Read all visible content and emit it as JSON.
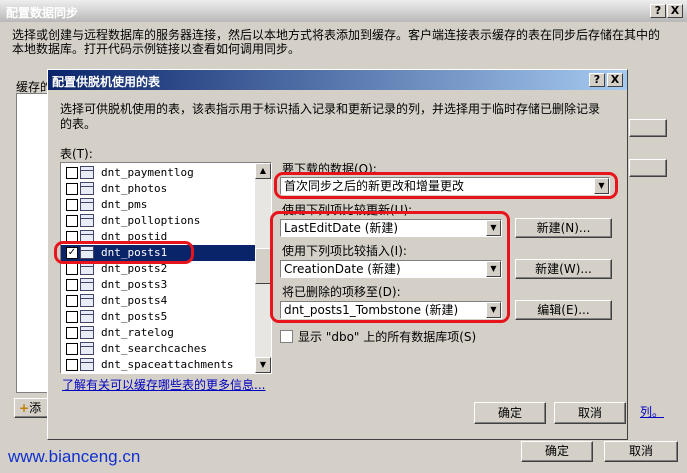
{
  "outer_dialog": {
    "title": "配置数据同步",
    "help_btn": "?",
    "close_btn": "X",
    "description_line1": "选择或创建与远程数据库的服务器连接，然后以本地方式将表添加到缓存。客户端连接表示缓存的表在同步后存储在其中的",
    "description_line2": "本地数据库。打开代码示例链接以查看如何调用同步。",
    "cache_label": "缓存的",
    "add_button": "添",
    "link_tail": "列。",
    "ok_button": "确定",
    "cancel_button": "取消"
  },
  "inner_dialog": {
    "title": "配置供脱机使用的表",
    "help_btn": "?",
    "close_btn": "X",
    "description_line1": "选择可供脱机使用的表，该表指示用于标识插入记录和更新记录的列，并选择用于临时存储已删除记录",
    "description_line2": "的表。",
    "tables_label": "表(T):",
    "tables": [
      {
        "name": "dnt_paymentlog",
        "checked": false
      },
      {
        "name": "dnt_photos",
        "checked": false
      },
      {
        "name": "dnt_pms",
        "checked": false
      },
      {
        "name": "dnt_polloptions",
        "checked": false
      },
      {
        "name": "dnt_postid",
        "checked": false
      },
      {
        "name": "dnt_posts1",
        "checked": true
      },
      {
        "name": "dnt_posts2",
        "checked": false
      },
      {
        "name": "dnt_posts3",
        "checked": false
      },
      {
        "name": "dnt_posts4",
        "checked": false
      },
      {
        "name": "dnt_posts5",
        "checked": false
      },
      {
        "name": "dnt_ratelog",
        "checked": false
      },
      {
        "name": "dnt_searchcaches",
        "checked": false
      },
      {
        "name": "dnt_spaceattachments",
        "checked": false
      }
    ],
    "check_mark": "✓",
    "learn_more_link": "了解有关可以缓存哪些表的更多信息...",
    "download_label": "要下载的数据(O):",
    "download_value": "首次同步之后的新更改和增量更改",
    "compare_update_label": "使用下列项比较更新(U):",
    "compare_update_value": "LastEditDate (新建)",
    "compare_update_button": "新建(N)...",
    "compare_insert_label": "使用下列项比较插入(I):",
    "compare_insert_value": "CreationDate (新建)",
    "compare_insert_button": "新建(W)...",
    "move_deleted_label": "将已删除的项移至(D):",
    "move_deleted_value": "dnt_posts1_Tombstone (新建)",
    "move_deleted_button": "编辑(E)...",
    "show_all_label": "显示 \"dbo\" 上的所有数据库项(S)",
    "ok_button": "确定",
    "cancel_button": "取消"
  },
  "watermark": "www.bianceng.cn"
}
